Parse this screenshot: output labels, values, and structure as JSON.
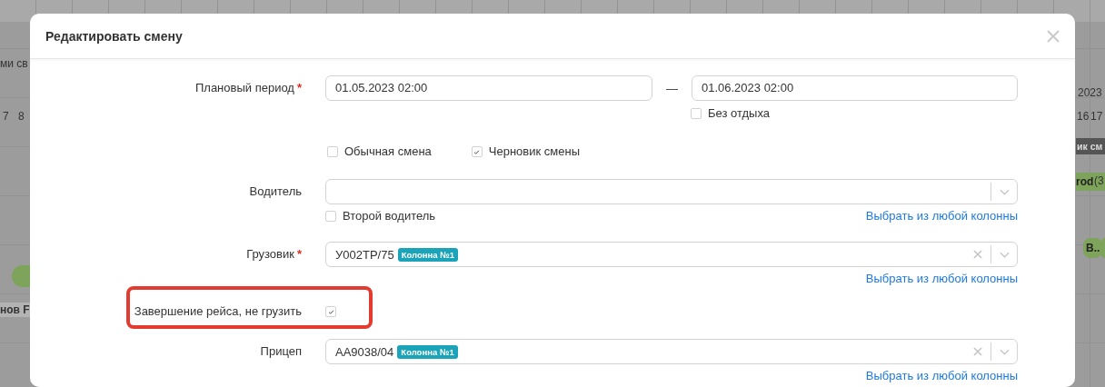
{
  "background": {
    "fragments": [
      {
        "text": "ми св",
        "kind": "plain"
      },
      {
        "text": "7",
        "kind": "plain"
      },
      {
        "text": "8",
        "kind": "plain"
      },
      {
        "text": "нов F",
        "kind": "light-bar"
      },
      {
        "text": "2023",
        "kind": "plain"
      },
      {
        "text": "16",
        "kind": "plain"
      },
      {
        "text": "17",
        "kind": "plain"
      },
      {
        "text": "ик см",
        "kind": "dark-bar"
      },
      {
        "text": "rod",
        "kind": "green-bar"
      },
      {
        "text": "(3",
        "kind": "plain"
      },
      {
        "text": "В..",
        "kind": "green-pill"
      }
    ]
  },
  "dialog": {
    "title": "Редактировать смену",
    "rows": [
      {
        "kind": "period",
        "label": "Плановый период",
        "required_mark": "*",
        "start": "01.05.2023 02:00",
        "separator": "—",
        "end": "01.06.2023 02:00",
        "extra_check": {
          "label": "Без отдыха",
          "checked": false
        }
      },
      {
        "kind": "checks",
        "checks": [
          {
            "label": "Обычная смена",
            "checked": false
          },
          {
            "label": "Черновик смены",
            "checked": true
          }
        ]
      },
      {
        "kind": "select",
        "label": "Водитель",
        "clearable": false,
        "extra_check": {
          "label": "Второй водитель",
          "checked": false
        },
        "link": "Выбрать из любой колонны"
      },
      {
        "kind": "select",
        "label": "Грузовик",
        "required_mark": "*",
        "value": "У002ТР/75",
        "tag": "Колонна №1",
        "clearable": true,
        "link": "Выбрать из любой колонны"
      },
      {
        "kind": "checkbox",
        "label": "Завершение рейса, не грузить",
        "checked": true,
        "highlighted": true
      },
      {
        "kind": "select",
        "label": "Прицеп",
        "value": "АА9038/04",
        "tag": "Колонна №1",
        "clearable": true,
        "link": "Выбрать из любой колонны"
      }
    ]
  }
}
